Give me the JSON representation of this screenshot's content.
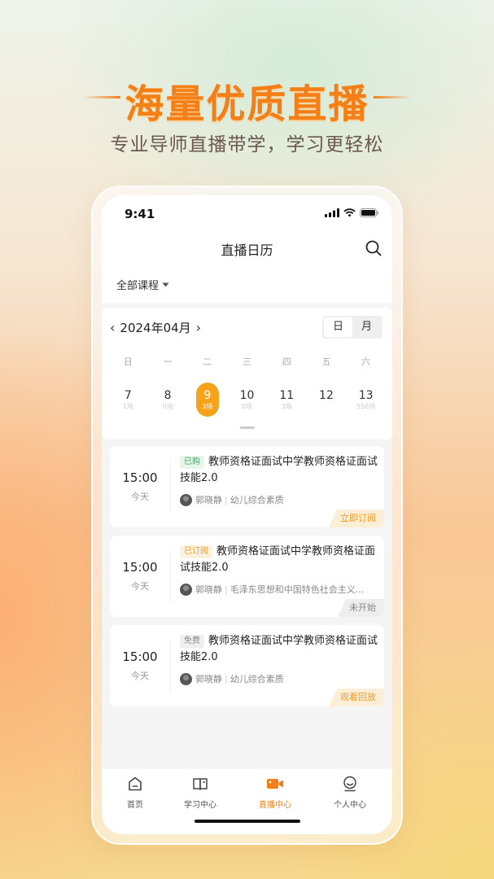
{
  "hero": {
    "title": "海量优质直播",
    "subtitle": "专业导师直播带学，学习更轻松"
  },
  "status_bar": {
    "time": "9:41"
  },
  "header": {
    "title": "直播日历",
    "search_icon": "search-icon"
  },
  "filter": {
    "label": "全部课程",
    "icon": "caret-down-icon"
  },
  "calendar": {
    "month_label": "2024年04月",
    "view_day": "日",
    "view_month": "月",
    "active_view": "日",
    "weekdays": [
      "日",
      "一",
      "二",
      "三",
      "四",
      "五",
      "六"
    ],
    "days": [
      {
        "num": "7",
        "count": "1场"
      },
      {
        "num": "8",
        "count": "0场"
      },
      {
        "num": "9",
        "count": "3场"
      },
      {
        "num": "10",
        "count": "0场"
      },
      {
        "num": "11",
        "count": "3场"
      },
      {
        "num": "12",
        "count": ""
      },
      {
        "num": "13",
        "count": "556场"
      }
    ],
    "selected_day": "9",
    "accent": "#f7a21b"
  },
  "sessions": [
    {
      "time": "15:00",
      "day": "今天",
      "tag": "已购",
      "tag_style": "green",
      "title": "教师资格证面试中学教师资格证面试技能2.0",
      "teacher": "郭晓静",
      "category": "幼儿综合素质",
      "action": "立即订阅",
      "action_style": "orange"
    },
    {
      "time": "15:00",
      "day": "今天",
      "tag": "已订阅",
      "tag_style": "orange",
      "title": "教师资格证面试中学教师资格证面试技能2.0",
      "teacher": "郭晓静",
      "category": "毛泽东思想和中国特色社会主义...",
      "action": "未开始",
      "action_style": "gray"
    },
    {
      "time": "15:00",
      "day": "今天",
      "tag": "免费",
      "tag_style": "gray",
      "title": "教师资格证面试中学教师资格证面试技能2.0",
      "teacher": "郭晓静",
      "category": "幼儿综合素质",
      "action": "观看回放",
      "action_style": "orange"
    }
  ],
  "tabbar": {
    "items": [
      {
        "label": "首页",
        "icon": "home-icon"
      },
      {
        "label": "学习中心",
        "icon": "book-icon"
      },
      {
        "label": "直播中心",
        "icon": "video-camera-icon"
      },
      {
        "label": "个人中心",
        "icon": "user-icon"
      }
    ],
    "active": "直播中心",
    "active_color": "#f47f16"
  }
}
